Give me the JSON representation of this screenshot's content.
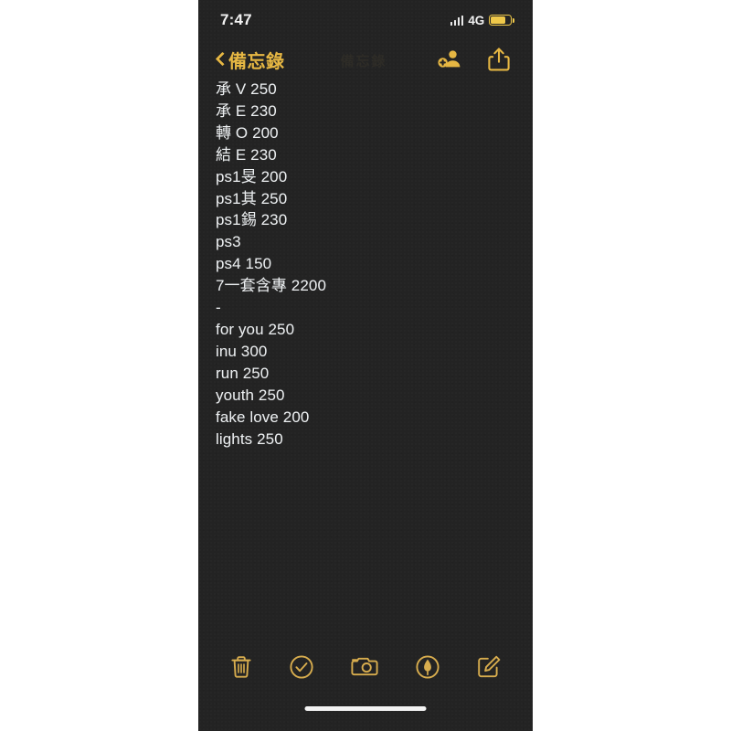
{
  "status_bar": {
    "time": "7:47",
    "carrier": "4G",
    "signal_icon": "signal-bars-icon",
    "battery_icon": "battery-icon",
    "battery_level_percent": 78,
    "accent_color": "#efc84a"
  },
  "nav_bar": {
    "back_label": "備忘錄",
    "back_icon": "chevron-left-icon",
    "add_people_icon": "add-person-icon",
    "share_icon": "share-icon",
    "accent_color": "#e6b743"
  },
  "watermark": {
    "text": "備忘錄"
  },
  "note": {
    "lines": [
      "承 V 250",
      "承 E 230",
      "轉 O 200",
      "結 E 230",
      "ps1旻 200",
      "ps1其 250",
      "ps1錫 230",
      "ps3",
      "ps4 150",
      "7一套含專 2200",
      "-",
      "for you 250",
      "inu 300",
      "run 250",
      "youth 250",
      "fake love 200",
      "lights 250"
    ],
    "text_color": "#eceff1",
    "background_color": "#232323"
  },
  "toolbar": {
    "items": [
      {
        "name": "delete-button",
        "icon": "trash-icon"
      },
      {
        "name": "checklist-button",
        "icon": "check-circle-icon"
      },
      {
        "name": "camera-button",
        "icon": "camera-icon"
      },
      {
        "name": "markup-button",
        "icon": "markup-pen-icon"
      },
      {
        "name": "compose-button",
        "icon": "compose-icon"
      }
    ],
    "accent_color": "#d8ad4e"
  },
  "home_indicator": {
    "label": "home-indicator"
  }
}
